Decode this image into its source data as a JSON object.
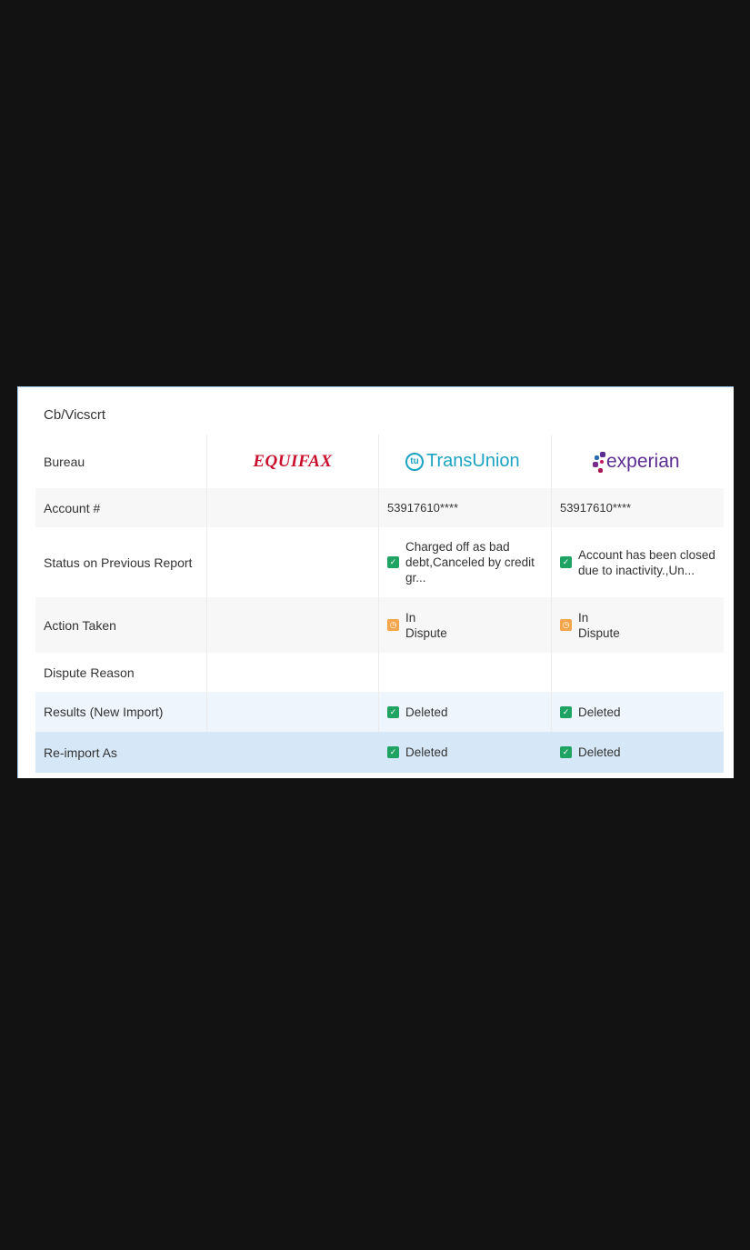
{
  "creditor": "Cb/Vicscrt",
  "bureaus": {
    "label": "Bureau",
    "equifax": "EQUIFAX",
    "transunion_mark": "tu",
    "transunion": "TransUnion",
    "experian": "experian"
  },
  "rows": {
    "account": {
      "label": "Account #",
      "equifax": "",
      "transunion": "53917610****",
      "experian": "53917610****"
    },
    "status": {
      "label": "Status on Previous Report",
      "transunion": "Charged off as bad debt,Canceled by credit gr...",
      "experian": "Account has been closed due to inactivity.,Un..."
    },
    "action": {
      "label": "Action Taken",
      "transunion": "In Dispute",
      "experian": "In Dispute"
    },
    "dispute_reason": {
      "label": "Dispute Reason",
      "transunion": "",
      "experian": ""
    },
    "results": {
      "label": "Results (New Import)",
      "transunion": "Deleted",
      "experian": "Deleted"
    },
    "reimport": {
      "label": "Re-import As",
      "transunion": "Deleted",
      "experian": "Deleted"
    }
  },
  "icons": {
    "check": "check-icon",
    "pending": "pending-icon"
  },
  "colors": {
    "background": "#121212",
    "equifax": "#c8102e",
    "transunion": "#1aa3c2",
    "experian": "#5c2d91",
    "check": "#1ea362",
    "pending": "#f5a54a",
    "reimport_row": "#d6e8f7"
  }
}
